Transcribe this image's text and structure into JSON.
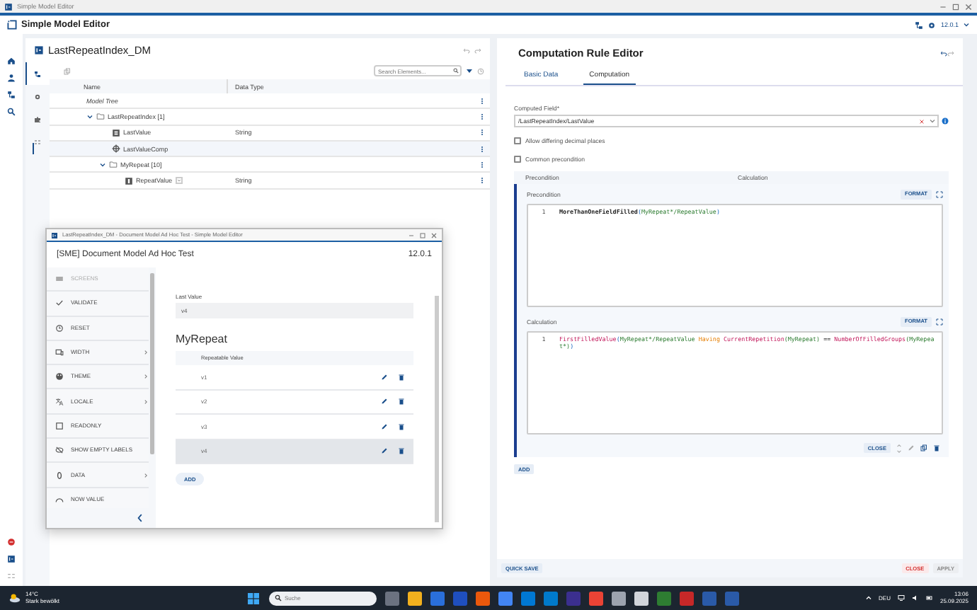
{
  "window": {
    "title": "Simple Model Editor"
  },
  "app_bar": {
    "title": "Simple Model Editor",
    "version": "12.0.1"
  },
  "model_panel": {
    "title": "LastRepeatIndex_DM",
    "side_tabs": [
      {
        "kind": "tree",
        "selected": true
      },
      {
        "kind": "gear",
        "selected": false
      },
      {
        "kind": "puzzle",
        "selected": false
      },
      {
        "kind": "list",
        "selected": false
      }
    ],
    "search": {
      "placeholder": "Search Elements..."
    },
    "columns": [
      "Name",
      "Data Type"
    ],
    "tree": [
      {
        "name": "Model Tree",
        "kind": "root",
        "selected": false,
        "children": [
          {
            "name": "LastRepeatIndex [1]",
            "kind": "group",
            "expanded": true,
            "selected": false,
            "children": [
              {
                "name": "LastValue",
                "kind": "field",
                "data_type": "String",
                "selected": false
              },
              {
                "name": "LastValueComp",
                "kind": "computation",
                "selected": true
              },
              {
                "name": "MyRepeat [10]",
                "kind": "group",
                "expanded": true,
                "selected": false,
                "children": [
                  {
                    "name": "RepeatValue",
                    "kind": "repeat_field",
                    "data_type": "String",
                    "selected": false
                  }
                ]
              }
            ]
          }
        ]
      }
    ]
  },
  "rule_editor": {
    "title": "Computation Rule Editor",
    "tabs": [
      {
        "label": "Basic Data",
        "selected": false
      },
      {
        "label": "Computation",
        "selected": true
      }
    ],
    "computed_field": {
      "label": "Computed Field*",
      "value": "/LastRepeatIndex/LastValue"
    },
    "options": [
      {
        "label": "Allow differing decimal places",
        "checked": false
      },
      {
        "label": "Common precondition",
        "checked": false
      }
    ],
    "columns": [
      "Precondition",
      "Calculation"
    ],
    "rule": {
      "sections": [
        {
          "label": "Precondition",
          "button": "FORMAT",
          "lines": [
            {
              "number": "1",
              "tokens": [
                {
                  "kind": "predicate",
                  "text": "MoreThanOneFieldFilled"
                },
                {
                  "kind": "bracket",
                  "text": "("
                },
                {
                  "kind": "path",
                  "text": "MyRepeat*/RepeatValue"
                },
                {
                  "kind": "bracket",
                  "text": ")"
                }
              ]
            }
          ]
        },
        {
          "label": "Calculation",
          "button": "FORMAT",
          "lines": [
            {
              "number": "1",
              "tokens": [
                {
                  "kind": "function",
                  "text": "FirstFilledValue"
                },
                {
                  "kind": "bracket",
                  "text": "("
                },
                {
                  "kind": "path",
                  "text": "MyRepeat*/RepeatValue"
                },
                {
                  "kind": "keyword",
                  "text": " Having "
                },
                {
                  "kind": "function",
                  "text": "CurrentRepetition"
                },
                {
                  "kind": "path",
                  "text": "(MyRepeat)"
                },
                {
                  "kind": "operator",
                  "text": " == "
                },
                {
                  "kind": "function",
                  "text": "NumberOfFilledGroups"
                },
                {
                  "kind": "path",
                  "text": "(MyRepeat*)"
                },
                {
                  "kind": "bracket",
                  "text": ")"
                }
              ]
            }
          ]
        }
      ],
      "close_button": "CLOSE"
    },
    "add_button": "ADD",
    "footer": {
      "quick_save": "QUICK SAVE",
      "close": "CLOSE",
      "apply": {
        "label": "APPLY",
        "disabled": true
      }
    }
  },
  "preview_window": {
    "title": "LastRepeatIndex_DM - Document Model Ad Hoc Test - Simple Model Editor",
    "header": "[SME] Document Model Ad Hoc Test",
    "version": "12.0.1",
    "menu": [
      {
        "label": "SCREENS",
        "kind": "screens",
        "disabled": true,
        "submenu": false
      },
      {
        "label": "VALIDATE",
        "kind": "validate",
        "disabled": false,
        "submenu": false
      },
      {
        "label": "RESET",
        "kind": "reset",
        "disabled": false,
        "submenu": false
      },
      {
        "label": "WIDTH",
        "kind": "width",
        "disabled": false,
        "submenu": true
      },
      {
        "label": "THEME",
        "kind": "theme",
        "disabled": false,
        "submenu": true
      },
      {
        "label": "LOCALE",
        "kind": "locale",
        "disabled": false,
        "submenu": true
      },
      {
        "label": "READONLY",
        "kind": "readonly",
        "disabled": false,
        "submenu": false
      },
      {
        "label": "SHOW EMPTY LABELS",
        "kind": "labels",
        "disabled": false,
        "submenu": false
      },
      {
        "label": "DATA",
        "kind": "data",
        "disabled": false,
        "submenu": true
      },
      {
        "label": "NOW VALUE",
        "kind": "now",
        "disabled": false,
        "submenu": false
      }
    ],
    "last_value": {
      "label": "Last Value",
      "value": "v4"
    },
    "section_title": "MyRepeat",
    "table": {
      "column": "Repeatable Value",
      "rows": [
        {
          "value": "v1",
          "selected": false
        },
        {
          "value": "v2",
          "selected": false
        },
        {
          "value": "v3",
          "selected": false
        },
        {
          "value": "v4",
          "selected": true
        }
      ]
    },
    "add_button": "ADD"
  },
  "taskbar": {
    "temperature": "14°C",
    "condition": "Stark bewölkt",
    "search": {
      "placeholder": "Suche"
    },
    "language": "DEU",
    "time": "13:06",
    "date": "25.09.2025"
  }
}
